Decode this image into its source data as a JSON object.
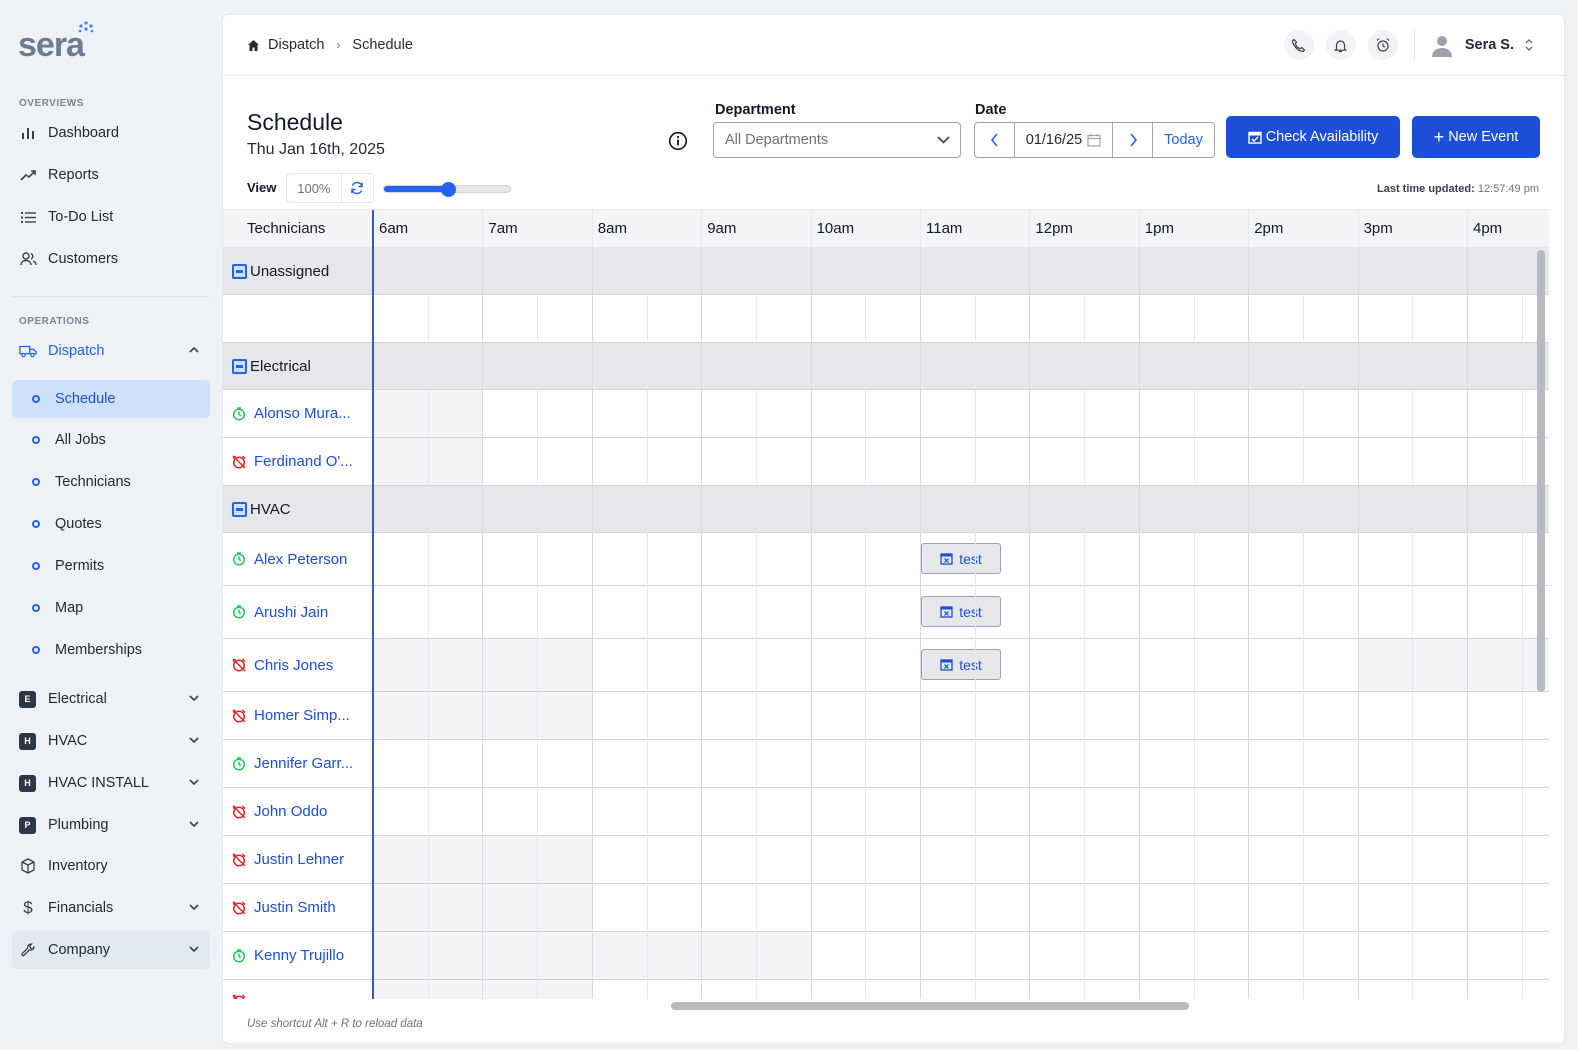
{
  "app": {
    "logo": "sera"
  },
  "sidebar": {
    "overviews_label": "OVERVIEWS",
    "operations_label": "OPERATIONS",
    "overviews": [
      {
        "label": "Dashboard",
        "icon": "bar-chart-icon"
      },
      {
        "label": "Reports",
        "icon": "trend-icon"
      },
      {
        "label": "To-Do List",
        "icon": "list-icon"
      },
      {
        "label": "Customers",
        "icon": "users-icon"
      }
    ],
    "dispatch": {
      "label": "Dispatch",
      "icon": "truck-icon",
      "children": [
        {
          "label": "Schedule",
          "active": true
        },
        {
          "label": "All Jobs"
        },
        {
          "label": "Technicians"
        },
        {
          "label": "Quotes"
        },
        {
          "label": "Permits"
        },
        {
          "label": "Map"
        },
        {
          "label": "Memberships"
        }
      ]
    },
    "departments": [
      {
        "badge": "E",
        "label": "Electrical"
      },
      {
        "badge": "H",
        "label": "HVAC"
      },
      {
        "badge": "H",
        "label": "HVAC INSTALL"
      },
      {
        "badge": "P",
        "label": "Plumbing"
      }
    ],
    "inventory": "Inventory",
    "financials": "Financials",
    "company": "Company"
  },
  "header": {
    "breadcrumb": [
      "Dispatch",
      "Schedule"
    ],
    "user": "Sera S."
  },
  "page": {
    "title": "Schedule",
    "date": "Thu Jan 16th, 2025",
    "department_label": "Department",
    "department_value": "All Departments",
    "date_label": "Date",
    "date_value": "01/16/25",
    "today": "Today",
    "check_availability": "Check Availability",
    "new_event": "New Event",
    "view_label": "View",
    "zoom": "100%",
    "zoom_slider_fraction": 0.5,
    "last_updated_label": "Last time updated:",
    "last_updated_value": "12:57:49 pm",
    "footnote": "Use shortcut Alt + R to reload data"
  },
  "schedule": {
    "technicians_header": "Technicians",
    "hours": [
      "6am",
      "7am",
      "8am",
      "9am",
      "10am",
      "11am",
      "12pm",
      "1pm",
      "2pm",
      "3pm",
      "4pm"
    ],
    "groups": {
      "unassigned": "Unassigned",
      "electrical": "Electrical",
      "hvac": "HVAC"
    },
    "technicians": [
      {
        "name": "Alonso Mura...",
        "status": "available"
      },
      {
        "name": "Ferdinand O'...",
        "status": "unavailable"
      },
      {
        "name": "Alex Peterson",
        "status": "available"
      },
      {
        "name": "Arushi Jain",
        "status": "available"
      },
      {
        "name": "Chris Jones",
        "status": "unavailable"
      },
      {
        "name": "Homer Simp...",
        "status": "unavailable"
      },
      {
        "name": "Jennifer Garr...",
        "status": "available"
      },
      {
        "name": "John Oddo",
        "status": "unavailable"
      },
      {
        "name": "Justin Lehner",
        "status": "unavailable"
      },
      {
        "name": "Justin Smith",
        "status": "unavailable"
      },
      {
        "name": "Kenny Trujillo",
        "status": "available"
      }
    ],
    "event_label": "test",
    "colors": {
      "accent": "#1d4ed8",
      "available": "#22c55e",
      "unavailable": "#dc2626"
    }
  }
}
